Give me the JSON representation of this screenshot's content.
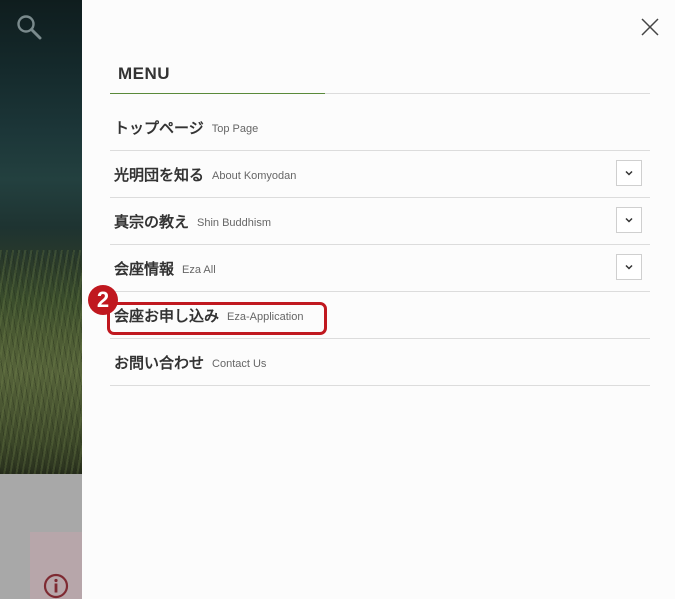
{
  "background": {
    "icons": [
      "search-icon",
      "info-icon"
    ]
  },
  "menu": {
    "title": "MENU",
    "close_icon": "close-icon",
    "items": [
      {
        "jp": "トップページ",
        "en": "Top Page",
        "expandable": false
      },
      {
        "jp": "光明団を知る",
        "en": "About Komyodan",
        "expandable": true
      },
      {
        "jp": "真宗の教え",
        "en": "Shin Buddhism",
        "expandable": true
      },
      {
        "jp": "会座情報",
        "en": "Eza All",
        "expandable": true
      },
      {
        "jp": "会座お申し込み",
        "en": "Eza-Application",
        "expandable": false
      },
      {
        "jp": "お問い合わせ",
        "en": "Contact Us",
        "expandable": false
      }
    ]
  },
  "annotation": {
    "step_number": "2",
    "highlight_color": "#c0181f",
    "highlighted_item": "会座お申し込み"
  },
  "colors": {
    "accent_line": "#5a8a3a",
    "divider": "#dcdcdc"
  }
}
